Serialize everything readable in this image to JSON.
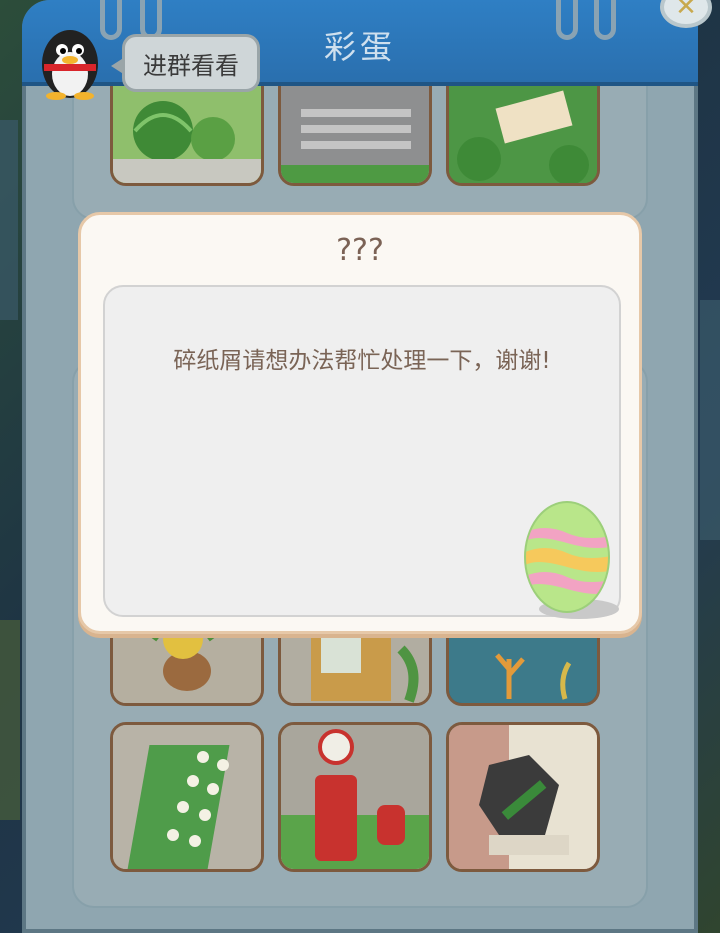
{
  "header": {
    "title": "彩蛋",
    "close_icon": "close-x-icon"
  },
  "chat_prompt": {
    "label": "进群看看",
    "avatar_icon": "qq-penguin-icon"
  },
  "dialog": {
    "title": "???",
    "message": "碎纸屑请想办法帮忙处理一下，谢谢!",
    "decoration_icon": "easter-egg-icon"
  },
  "tiles": [
    "watermelon-garden",
    "crosswalk",
    "envelope-lawn",
    "potted-plant",
    "vending-machine",
    "aquarium-coral",
    "flower-planter",
    "mailbox-hydrant",
    "broken-debris"
  ],
  "colors": {
    "header": "#2f7fc4",
    "dialog_border": "#e6c8a8",
    "tile_border": "#7d5a3e"
  }
}
